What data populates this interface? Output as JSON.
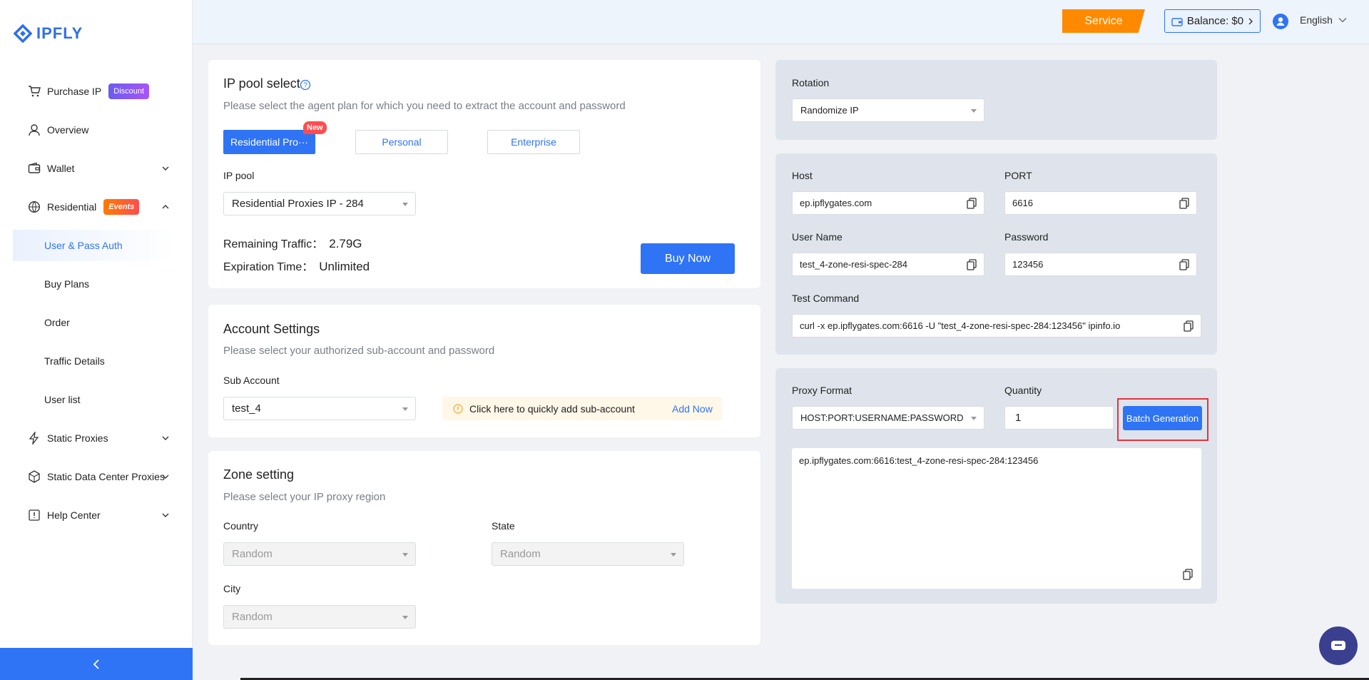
{
  "brand": {
    "name": "IPFLY"
  },
  "sidebar": {
    "items": [
      {
        "label": "Purchase IP",
        "badge": "Discount"
      },
      {
        "label": "Overview"
      },
      {
        "label": "Wallet"
      },
      {
        "label": "Residential",
        "badge": "Events"
      },
      {
        "label": "Static Proxies"
      },
      {
        "label": "Static Data Center Proxies"
      },
      {
        "label": "Help Center"
      }
    ],
    "sub_items": [
      "User & Pass Auth",
      "Buy Plans",
      "Order",
      "Traffic Details",
      "User list"
    ]
  },
  "header": {
    "service_label": "Service",
    "balance_label": "Balance: $0",
    "language": "English"
  },
  "ip_pool": {
    "title": "IP pool select",
    "subtitle": "Please select the agent plan for which you need to extract the account and password",
    "tabs": [
      "Residential Pro···",
      "Personal",
      "Enterprise"
    ],
    "new_badge": "New",
    "pool_label": "IP pool",
    "pool_value": "Residential Proxies IP - 284",
    "remaining_label": "Remaining Traffic：",
    "remaining_value": "2.79G",
    "expiration_label": "Expiration Time：",
    "expiration_value": "Unlimited",
    "buy_label": "Buy Now"
  },
  "account": {
    "title": "Account Settings",
    "subtitle": "Please select your authorized sub-account and password",
    "sub_account_label": "Sub Account",
    "sub_account_value": "test_4",
    "tip_text": "Click here to quickly add sub-account",
    "add_now": "Add Now"
  },
  "zone": {
    "title": "Zone setting",
    "subtitle": "Please select your IP proxy region",
    "country_label": "Country",
    "country_value": "Random",
    "state_label": "State",
    "state_value": "Random",
    "city_label": "City",
    "city_value": "Random"
  },
  "rotation": {
    "label": "Rotation",
    "value": "Randomize IP"
  },
  "connection": {
    "host_label": "Host",
    "host_value": "ep.ipflygates.com",
    "port_label": "PORT",
    "port_value": "6616",
    "user_label": "User Name",
    "user_value": "test_4-zone-resi-spec-284",
    "password_label": "Password",
    "password_value": "123456",
    "test_label": "Test Command",
    "test_value": "curl -x ep.ipflygates.com:6616 -U \"test_4-zone-resi-spec-284:123456\" ipinfo.io"
  },
  "generation": {
    "format_label": "Proxy Format",
    "format_value": "HOST:PORT:USERNAME:PASSWORD",
    "quantity_label": "Quantity",
    "quantity_value": "1",
    "batch_label": "Batch Generation",
    "output": "ep.ipflygates.com:6616:test_4-zone-resi-spec-284:123456"
  },
  "colors": {
    "accent": "#2f74f5",
    "service": "#ff8a00",
    "highlight": "#e8323c"
  }
}
